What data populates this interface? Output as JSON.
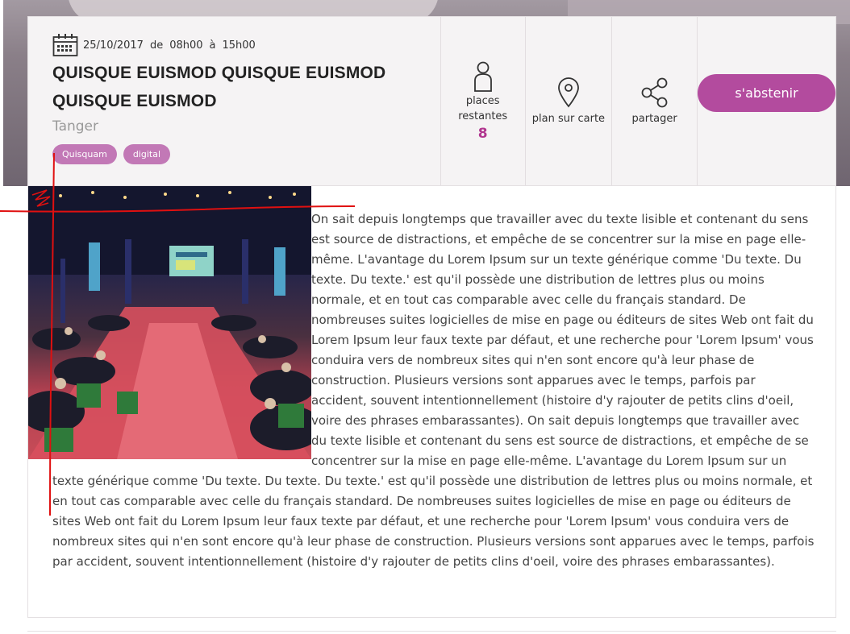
{
  "event": {
    "date": "25/10/2017",
    "from_word": "de",
    "start_time": "08h00",
    "to_word": "à",
    "end_time": "15h00",
    "title_line1": "QUISQUE EUISMOD QUISQUE EUISMOD",
    "title_line2": "QUISQUE EUISMOD",
    "city": "Tanger",
    "tags": [
      "Quisquam",
      "digital"
    ]
  },
  "actions": {
    "places_label_1": "places",
    "places_label_2": "restantes",
    "places_count": "8",
    "plan_label": "plan sur carte",
    "share_label": "partager",
    "cta_label": "s'abstenir"
  },
  "icons": {
    "calendar": "calendar-icon",
    "person": "person-icon",
    "map_pin": "map-pin-icon",
    "share": "share-icon"
  },
  "colors": {
    "accent": "#b34b9e",
    "tag": "#c278b6",
    "count": "#b1368f"
  },
  "body": {
    "paragraph": "On sait depuis longtemps que travailler avec du texte lisible et contenant du sens est source de distractions, et empêche de se concentrer sur la mise en page elle-même. L'avantage du Lorem Ipsum sur un texte générique comme 'Du texte. Du texte. Du texte.' est qu'il possède une distribution de lettres plus ou moins normale, et en tout cas comparable avec celle du français standard. De nombreuses suites logicielles de mise en page ou éditeurs de sites Web ont fait du Lorem Ipsum leur faux texte par défaut, et une recherche pour 'Lorem Ipsum' vous conduira vers de nombreux sites qui n'en sont encore qu'à leur phase de construction. Plusieurs versions sont apparues avec le temps, parfois par accident, souvent intentionnellement (histoire d'y rajouter de petits clins d'oeil, voire des phrases embarassantes). On sait depuis longtemps que travailler avec du texte lisible et contenant du sens est source de distractions, et empêche de se concentrer sur la mise en page elle-même. L'avantage du Lorem Ipsum sur un texte générique comme 'Du texte. Du texte. Du texte.' est qu'il possède une distribution de lettres plus ou moins normale, et en tout cas comparable avec celle du français standard. De nombreuses suites logicielles de mise en page ou éditeurs de sites Web ont fait du Lorem Ipsum leur faux texte par défaut, et une recherche pour 'Lorem Ipsum' vous conduira vers de nombreux sites qui n'en sont encore qu'à leur phase de construction. Plusieurs versions sont apparues avec le temps, parfois par accident, souvent intentionnellement (histoire d'y rajouter de petits clins d'oeil, voire des phrases embarassantes)."
  }
}
